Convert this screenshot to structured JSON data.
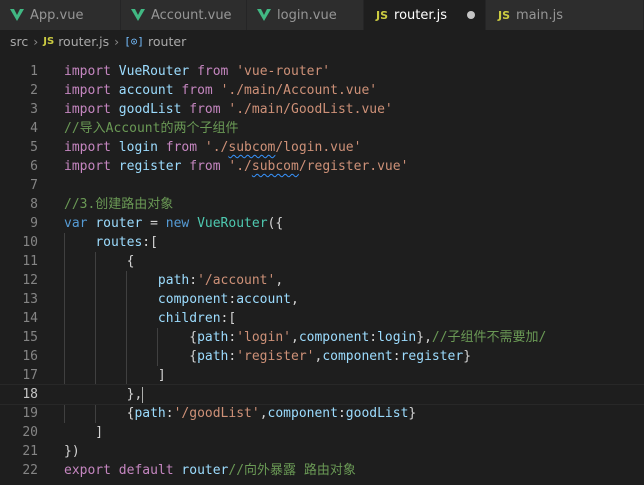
{
  "tabs": [
    {
      "label": "App.vue",
      "icon": "vue-file-icon",
      "active": false
    },
    {
      "label": "Account.vue",
      "icon": "vue-file-icon",
      "active": false
    },
    {
      "label": "login.vue",
      "icon": "vue-file-icon",
      "active": false
    },
    {
      "label": "router.js",
      "icon": "js-file-icon",
      "active": true,
      "modified": true
    },
    {
      "label": "main.js",
      "icon": "js-file-icon",
      "active": false
    }
  ],
  "js_badge": "JS",
  "breadcrumb": {
    "folder": "src",
    "file": "router.js",
    "symbol_icon": "[⊙]",
    "symbol": "router"
  },
  "editor": {
    "current_line": 18,
    "lines": [
      {
        "n": "1",
        "tokens": [
          {
            "c": "kc",
            "t": "import"
          },
          {
            "c": "pn",
            "t": " "
          },
          {
            "c": "id",
            "t": "VueRouter"
          },
          {
            "c": "pn",
            "t": " "
          },
          {
            "c": "kc",
            "t": "from"
          },
          {
            "c": "pn",
            "t": " "
          },
          {
            "c": "str",
            "t": "'vue-router'"
          }
        ]
      },
      {
        "n": "2",
        "tokens": [
          {
            "c": "kc",
            "t": "import"
          },
          {
            "c": "pn",
            "t": " "
          },
          {
            "c": "id",
            "t": "account"
          },
          {
            "c": "pn",
            "t": " "
          },
          {
            "c": "kc",
            "t": "from"
          },
          {
            "c": "pn",
            "t": " "
          },
          {
            "c": "str",
            "t": "'./main/Account.vue'"
          }
        ]
      },
      {
        "n": "3",
        "tokens": [
          {
            "c": "kc",
            "t": "import"
          },
          {
            "c": "pn",
            "t": " "
          },
          {
            "c": "id",
            "t": "goodList"
          },
          {
            "c": "pn",
            "t": " "
          },
          {
            "c": "kc",
            "t": "from"
          },
          {
            "c": "pn",
            "t": " "
          },
          {
            "c": "str",
            "t": "'./main/GoodList.vue'"
          }
        ]
      },
      {
        "n": "4",
        "tokens": [
          {
            "c": "cm",
            "t": "//导入Account的两个子组件"
          }
        ]
      },
      {
        "n": "5",
        "tokens": [
          {
            "c": "kc",
            "t": "import"
          },
          {
            "c": "pn",
            "t": " "
          },
          {
            "c": "id",
            "t": "login"
          },
          {
            "c": "pn",
            "t": " "
          },
          {
            "c": "kc",
            "t": "from"
          },
          {
            "c": "pn",
            "t": " "
          },
          {
            "c": "str",
            "t": "'./"
          },
          {
            "c": "str squig",
            "t": "subcom"
          },
          {
            "c": "str",
            "t": "/login.vue'"
          }
        ]
      },
      {
        "n": "6",
        "tokens": [
          {
            "c": "kc",
            "t": "import"
          },
          {
            "c": "pn",
            "t": " "
          },
          {
            "c": "id",
            "t": "register"
          },
          {
            "c": "pn",
            "t": " "
          },
          {
            "c": "kc",
            "t": "from"
          },
          {
            "c": "pn",
            "t": " "
          },
          {
            "c": "str",
            "t": "'./"
          },
          {
            "c": "str squig",
            "t": "subcom"
          },
          {
            "c": "str",
            "t": "/register.vue'"
          }
        ]
      },
      {
        "n": "7",
        "tokens": []
      },
      {
        "n": "8",
        "tokens": [
          {
            "c": "cm",
            "t": "//3.创建路由对象"
          }
        ]
      },
      {
        "n": "9",
        "tokens": [
          {
            "c": "kw",
            "t": "var"
          },
          {
            "c": "pn",
            "t": " "
          },
          {
            "c": "id",
            "t": "router"
          },
          {
            "c": "pn",
            "t": " = "
          },
          {
            "c": "kw",
            "t": "new"
          },
          {
            "c": "pn",
            "t": " "
          },
          {
            "c": "fn",
            "t": "VueRouter"
          },
          {
            "c": "pn",
            "t": "({"
          }
        ]
      },
      {
        "n": "10",
        "tokens": [
          {
            "c": "pn",
            "t": "    "
          },
          {
            "c": "id",
            "t": "routes"
          },
          {
            "c": "pn",
            "t": ":["
          }
        ]
      },
      {
        "n": "11",
        "tokens": [
          {
            "c": "pn",
            "t": "        {"
          }
        ]
      },
      {
        "n": "12",
        "tokens": [
          {
            "c": "pn",
            "t": "            "
          },
          {
            "c": "id",
            "t": "path"
          },
          {
            "c": "pn",
            "t": ":"
          },
          {
            "c": "str",
            "t": "'/account'"
          },
          {
            "c": "pn",
            "t": ","
          }
        ]
      },
      {
        "n": "13",
        "tokens": [
          {
            "c": "pn",
            "t": "            "
          },
          {
            "c": "id",
            "t": "component"
          },
          {
            "c": "pn",
            "t": ":"
          },
          {
            "c": "id",
            "t": "account"
          },
          {
            "c": "pn",
            "t": ","
          }
        ]
      },
      {
        "n": "14",
        "tokens": [
          {
            "c": "pn",
            "t": "            "
          },
          {
            "c": "id",
            "t": "children"
          },
          {
            "c": "pn",
            "t": ":["
          }
        ]
      },
      {
        "n": "15",
        "tokens": [
          {
            "c": "pn",
            "t": "                {"
          },
          {
            "c": "id",
            "t": "path"
          },
          {
            "c": "pn",
            "t": ":"
          },
          {
            "c": "str",
            "t": "'login'"
          },
          {
            "c": "pn",
            "t": ","
          },
          {
            "c": "id",
            "t": "component"
          },
          {
            "c": "pn",
            "t": ":"
          },
          {
            "c": "id",
            "t": "login"
          },
          {
            "c": "pn",
            "t": "},"
          },
          {
            "c": "cm",
            "t": "//子组件不需要加/"
          }
        ]
      },
      {
        "n": "16",
        "tokens": [
          {
            "c": "pn",
            "t": "                {"
          },
          {
            "c": "id",
            "t": "path"
          },
          {
            "c": "pn",
            "t": ":"
          },
          {
            "c": "str",
            "t": "'register'"
          },
          {
            "c": "pn",
            "t": ","
          },
          {
            "c": "id",
            "t": "component"
          },
          {
            "c": "pn",
            "t": ":"
          },
          {
            "c": "id",
            "t": "register"
          },
          {
            "c": "pn",
            "t": "}"
          }
        ]
      },
      {
        "n": "17",
        "tokens": [
          {
            "c": "pn",
            "t": "            ]"
          }
        ]
      },
      {
        "n": "18",
        "tokens": [
          {
            "c": "pn",
            "t": "        },"
          }
        ]
      },
      {
        "n": "19",
        "tokens": [
          {
            "c": "pn",
            "t": "        {"
          },
          {
            "c": "id",
            "t": "path"
          },
          {
            "c": "pn",
            "t": ":"
          },
          {
            "c": "str",
            "t": "'/goodList'"
          },
          {
            "c": "pn",
            "t": ","
          },
          {
            "c": "id",
            "t": "component"
          },
          {
            "c": "pn",
            "t": ":"
          },
          {
            "c": "id",
            "t": "goodList"
          },
          {
            "c": "pn",
            "t": "}"
          }
        ]
      },
      {
        "n": "20",
        "tokens": [
          {
            "c": "pn",
            "t": "    ]"
          }
        ]
      },
      {
        "n": "21",
        "tokens": [
          {
            "c": "pn",
            "t": "})"
          }
        ]
      },
      {
        "n": "22",
        "tokens": [
          {
            "c": "kc",
            "t": "export"
          },
          {
            "c": "pn",
            "t": " "
          },
          {
            "c": "kc",
            "t": "default"
          },
          {
            "c": "pn",
            "t": " "
          },
          {
            "c": "id",
            "t": "router"
          },
          {
            "c": "cm",
            "t": "//向外暴露 路由对象"
          }
        ]
      }
    ]
  },
  "colors": {
    "background": "#1e1e1e",
    "tabbar": "#252526",
    "vue_green": "#41b883",
    "js_yellow": "#cbcb41",
    "keyword": "#569cd6",
    "control_keyword": "#c586c0",
    "variable": "#9cdcfe",
    "class": "#4ec9b0",
    "string": "#ce9178",
    "comment": "#6a9955"
  }
}
